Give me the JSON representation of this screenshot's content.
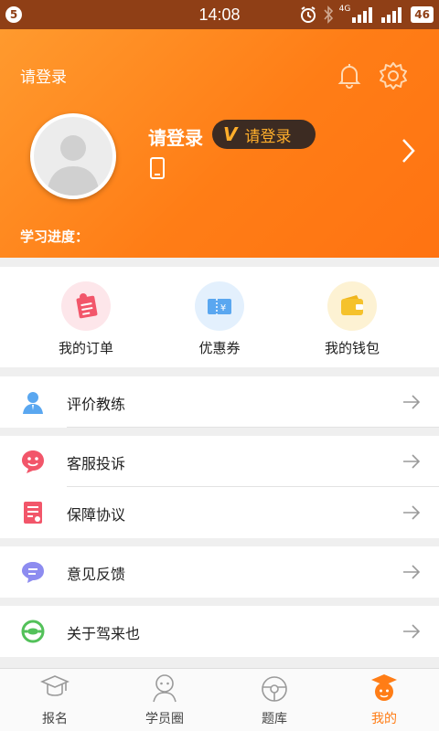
{
  "status_bar": {
    "notification_badge": "5",
    "time": "14:08",
    "battery": "46",
    "network": "4G",
    "icons": [
      "alarm-icon",
      "bluetooth-icon",
      "signal-icon",
      "battery-icon"
    ]
  },
  "header": {
    "top_login": "请登录",
    "name": "请登录",
    "vip_badge_letter": "V",
    "vip_label": "请登录",
    "progress_label": "学习进度：",
    "colors": {
      "gradient_start": "#ff9a2e",
      "gradient_end": "#ff7312",
      "pill_bg": "#3c2b22",
      "pill_text": "#ffae2b"
    }
  },
  "quick_actions": [
    {
      "label": "我的订单",
      "icon": "order-icon",
      "color": "#f2566a",
      "bg": "#fde6ea"
    },
    {
      "label": "优惠券",
      "icon": "coupon-icon",
      "color": "#5aa7f0",
      "bg": "#e3f0fd"
    },
    {
      "label": "我的钱包",
      "icon": "wallet-icon",
      "color": "#f5c22c",
      "bg": "#fdf2d3"
    }
  ],
  "menu": [
    {
      "label": "评价教练",
      "icon": "coach-icon"
    },
    {
      "label": "客服投诉",
      "icon": "service-icon"
    },
    {
      "label": "保障协议",
      "icon": "agreement-icon"
    },
    {
      "label": "意见反馈",
      "icon": "feedback-icon"
    },
    {
      "label": "关于驾来也",
      "icon": "about-icon"
    }
  ],
  "bottom_nav": [
    {
      "label": "报名",
      "icon": "graduation-cap-icon",
      "active": false
    },
    {
      "label": "学员圈",
      "icon": "student-circle-icon",
      "active": false
    },
    {
      "label": "题库",
      "icon": "steering-wheel-icon",
      "active": false
    },
    {
      "label": "我的",
      "icon": "profile-icon",
      "active": true
    }
  ],
  "accent_color": "#ff7d16"
}
